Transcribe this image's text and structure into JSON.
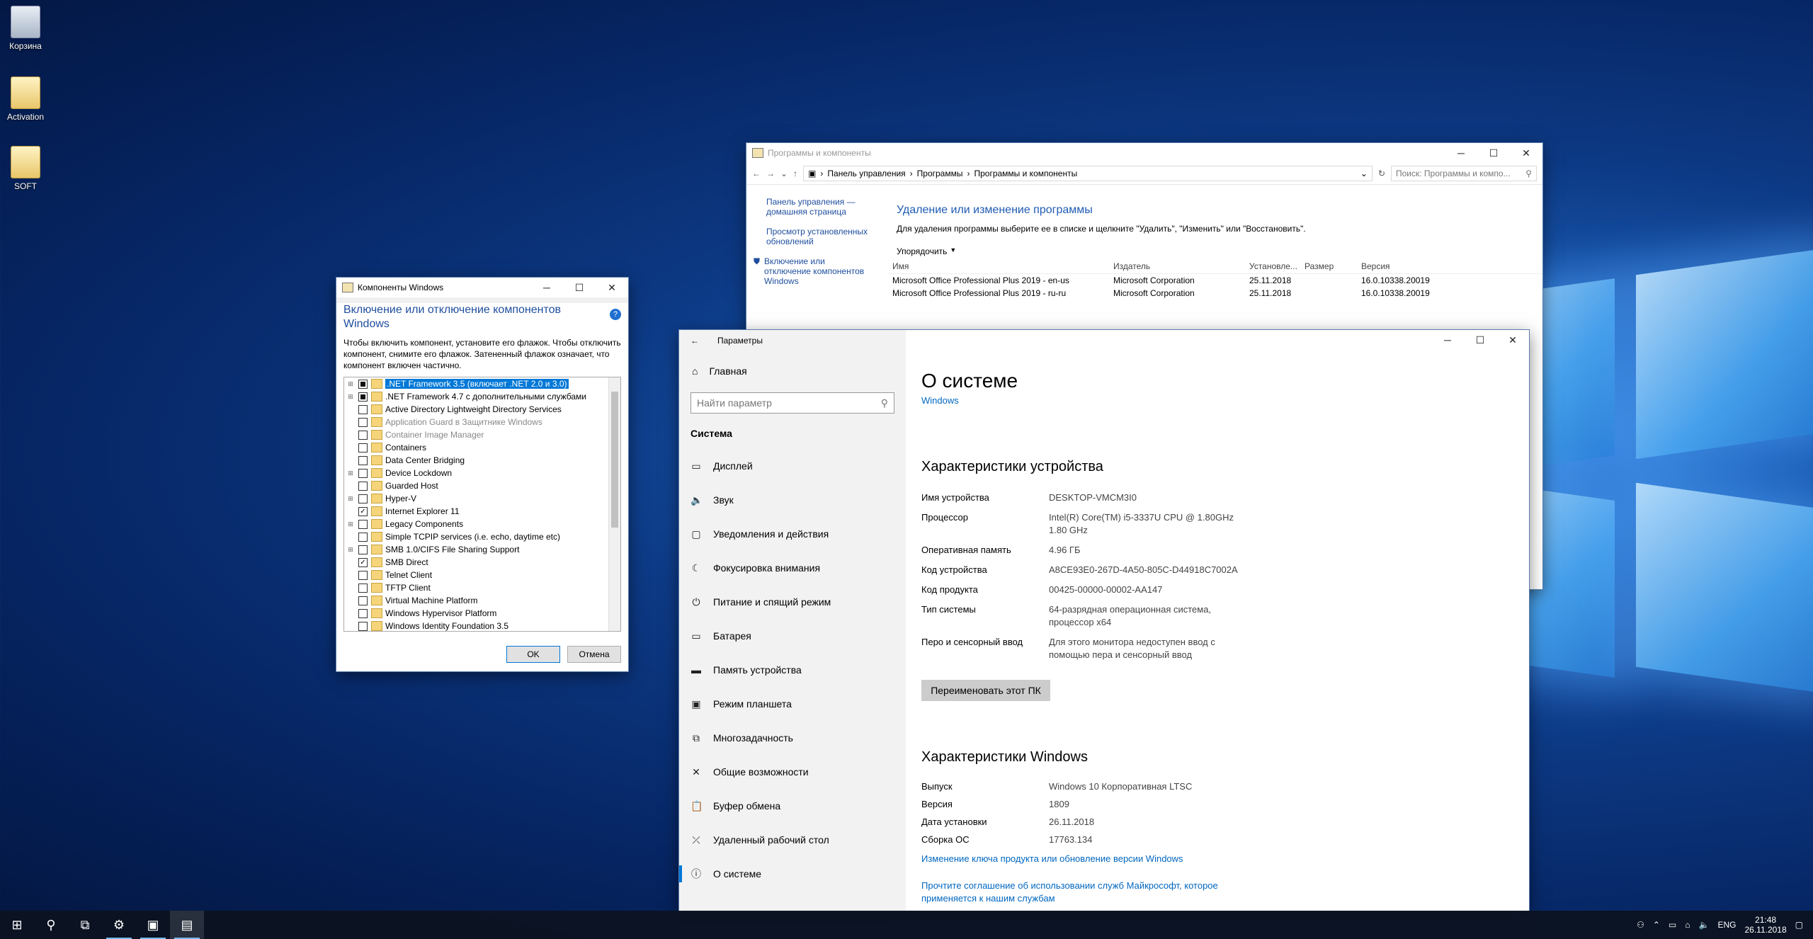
{
  "desktop": {
    "icons": [
      {
        "label": "Корзина",
        "icon": "recycle-bin-icon"
      },
      {
        "label": "Activation",
        "icon": "folder-icon"
      },
      {
        "label": "SOFT",
        "icon": "folder-icon"
      }
    ]
  },
  "programs": {
    "title": "Программы и компоненты",
    "breadcrumb": [
      "Панель управления",
      "Программы",
      "Программы и компоненты"
    ],
    "search_placeholder": "Поиск: Программы и компо...",
    "left_links": [
      "Панель управления — домашняя страница",
      "Просмотр установленных обновлений",
      "Включение или отключение компонентов Windows"
    ],
    "heading": "Удаление или изменение программы",
    "description": "Для удаления программы выберите ее в списке и щелкните \"Удалить\", \"Изменить\" или \"Восстановить\".",
    "organize": "Упорядочить",
    "columns": [
      "Имя",
      "Издатель",
      "Установле...",
      "Размер",
      "Версия"
    ],
    "rows": [
      {
        "name": "Microsoft Office Professional Plus 2019 - en-us",
        "publisher": "Microsoft Corporation",
        "installed": "25.11.2018",
        "size": "",
        "version": "16.0.10338.20019"
      },
      {
        "name": "Microsoft Office Professional Plus 2019 - ru-ru",
        "publisher": "Microsoft Corporation",
        "installed": "25.11.2018",
        "size": "",
        "version": "16.0.10338.20019"
      }
    ]
  },
  "components": {
    "title": "Компоненты Windows",
    "heading": "Включение или отключение компонентов Windows",
    "description": "Чтобы включить компонент, установите его флажок. Чтобы отключить компонент, снимите его флажок. Затененный флажок означает, что компонент включен частично.",
    "items": [
      {
        "label": ".NET Framework 3.5 (включает .NET 2.0 и 3.0)",
        "expandable": true,
        "state": "partial",
        "selected": true,
        "dim": false
      },
      {
        "label": ".NET Framework 4.7 с дополнительными службами",
        "expandable": true,
        "state": "partial",
        "selected": false,
        "dim": false
      },
      {
        "label": "Active Directory Lightweight Directory Services",
        "expandable": false,
        "state": "off",
        "selected": false,
        "dim": false
      },
      {
        "label": "Application Guard в Защитнике Windows",
        "expandable": false,
        "state": "off",
        "selected": false,
        "dim": true
      },
      {
        "label": "Container Image Manager",
        "expandable": false,
        "state": "off",
        "selected": false,
        "dim": true
      },
      {
        "label": "Containers",
        "expandable": false,
        "state": "off",
        "selected": false,
        "dim": false
      },
      {
        "label": "Data Center Bridging",
        "expandable": false,
        "state": "off",
        "selected": false,
        "dim": false
      },
      {
        "label": "Device Lockdown",
        "expandable": true,
        "state": "off",
        "selected": false,
        "dim": false
      },
      {
        "label": "Guarded Host",
        "expandable": false,
        "state": "off",
        "selected": false,
        "dim": false
      },
      {
        "label": "Hyper-V",
        "expandable": true,
        "state": "off",
        "selected": false,
        "dim": false
      },
      {
        "label": "Internet Explorer 11",
        "expandable": false,
        "state": "on",
        "selected": false,
        "dim": false
      },
      {
        "label": "Legacy Components",
        "expandable": true,
        "state": "off",
        "selected": false,
        "dim": false
      },
      {
        "label": "Simple TCPIP services (i.e. echo, daytime etc)",
        "expandable": false,
        "state": "off",
        "selected": false,
        "dim": false
      },
      {
        "label": "SMB 1.0/CIFS File Sharing Support",
        "expandable": true,
        "state": "off",
        "selected": false,
        "dim": false
      },
      {
        "label": "SMB Direct",
        "expandable": false,
        "state": "on",
        "selected": false,
        "dim": false
      },
      {
        "label": "Telnet Client",
        "expandable": false,
        "state": "off",
        "selected": false,
        "dim": false
      },
      {
        "label": "TFTP Client",
        "expandable": false,
        "state": "off",
        "selected": false,
        "dim": false
      },
      {
        "label": "Virtual Machine Platform",
        "expandable": false,
        "state": "off",
        "selected": false,
        "dim": false
      },
      {
        "label": "Windows Hypervisor Platform",
        "expandable": false,
        "state": "off",
        "selected": false,
        "dim": false
      },
      {
        "label": "Windows Identity Foundation 3.5",
        "expandable": false,
        "state": "off",
        "selected": false,
        "dim": false
      }
    ],
    "ok": "OK",
    "cancel": "Отмена"
  },
  "settings": {
    "title": "Параметры",
    "home": "Главная",
    "search_placeholder": "Найти параметр",
    "section": "Система",
    "nav": [
      {
        "label": "Дисплей",
        "icon": "display-icon",
        "glyph": "▭"
      },
      {
        "label": "Звук",
        "icon": "sound-icon",
        "glyph": "🔈"
      },
      {
        "label": "Уведомления и действия",
        "icon": "notifications-icon",
        "glyph": "▢"
      },
      {
        "label": "Фокусировка внимания",
        "icon": "focus-assist-icon",
        "glyph": "☾"
      },
      {
        "label": "Питание и спящий режим",
        "icon": "power-icon",
        "glyph": "⏻"
      },
      {
        "label": "Батарея",
        "icon": "battery-icon",
        "glyph": "▭"
      },
      {
        "label": "Память устройства",
        "icon": "storage-icon",
        "glyph": "▬"
      },
      {
        "label": "Режим планшета",
        "icon": "tablet-icon",
        "glyph": "▣"
      },
      {
        "label": "Многозадачность",
        "icon": "multitasking-icon",
        "glyph": "⧉"
      },
      {
        "label": "Общие возможности",
        "icon": "shared-experiences-icon",
        "glyph": "✕"
      },
      {
        "label": "Буфер обмена",
        "icon": "clipboard-icon",
        "glyph": "📋"
      },
      {
        "label": "Удаленный рабочий стол",
        "icon": "remote-desktop-icon",
        "glyph": "⤫"
      },
      {
        "label": "О системе",
        "icon": "info-icon",
        "glyph": "ⓘ"
      }
    ],
    "page_title": "О системе",
    "page_sub": "Windows",
    "device_heading": "Характеристики устройства",
    "device_specs": [
      {
        "k": "Имя устройства",
        "v": "DESKTOP-VMCM3I0"
      },
      {
        "k": "Процессор",
        "v": "Intel(R) Core(TM) i5-3337U CPU @ 1.80GHz 1.80 GHz"
      },
      {
        "k": "Оперативная память",
        "v": "4.96 ГБ"
      },
      {
        "k": "Код устройства",
        "v": "A8CE93E0-267D-4A50-805C-D44918C7002A"
      },
      {
        "k": "Код продукта",
        "v": "00425-00000-00002-AA147"
      },
      {
        "k": "Тип системы",
        "v": "64-разрядная операционная система, процессор x64"
      },
      {
        "k": "Перо и сенсорный ввод",
        "v": "Для этого монитора недоступен ввод с помощью пера и сенсорный ввод"
      }
    ],
    "rename_button": "Переименовать этот ПК",
    "windows_heading": "Характеристики Windows",
    "windows_specs": [
      {
        "k": "Выпуск",
        "v": "Windows 10 Корпоративная LTSC"
      },
      {
        "k": "Версия",
        "v": "1809"
      },
      {
        "k": "Дата установки",
        "v": "26.11.2018"
      },
      {
        "k": "Сборка ОС",
        "v": "17763.134"
      }
    ],
    "link_change_key": "Изменение ключа продукта или обновление версии Windows",
    "link_agreement": "Прочтите соглашение об использовании служб Майкрософт, которое применяется к нашим службам"
  },
  "taskbar": {
    "lang": "ENG",
    "time": "21:48",
    "date": "26.11.2018"
  }
}
